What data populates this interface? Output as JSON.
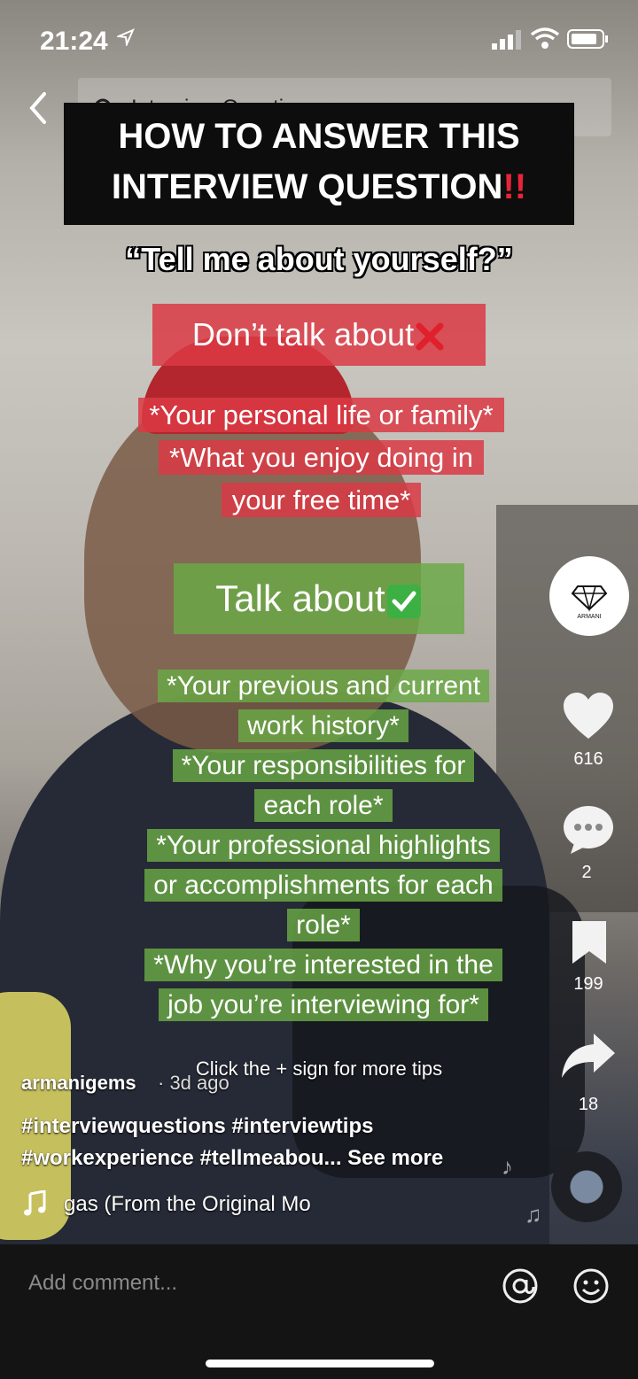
{
  "status_bar": {
    "time": "21:24"
  },
  "search": {
    "query": "Interview Questions"
  },
  "overlay": {
    "title_line1": "HOW TO ANSWER THIS",
    "title_line2": "INTERVIEW QUESTION",
    "title_emoji": "!!",
    "question": "“Tell me about yourself?”",
    "dont_heading": "Don’t talk about",
    "dont_items": [
      "*Your personal life or family*",
      "*What you enjoy doing in",
      "your free time*"
    ],
    "do_heading": "Talk about",
    "do_items": [
      "*Your previous and current",
      "work history*",
      "*Your responsibilities for",
      "each role*",
      "*Your professional highlights",
      "or accomplishments for each",
      "role*",
      "*Why you’re interested in the",
      "job you’re interviewing for*"
    ],
    "tip": "Click the + sign for more tips"
  },
  "rail": {
    "likes": "616",
    "comments": "2",
    "saves": "199",
    "shares": "18",
    "avatar_brand": "ARMANI"
  },
  "caption": {
    "username": "armanigems",
    "age": "· 3d ago",
    "hashtags_line1": "#interviewquestions #interviewtips",
    "hashtags_line2": "#workexperience #tellmeabou...",
    "see_more": "See more",
    "song": "gas (From the Original Mo"
  },
  "comment_bar": {
    "placeholder": "Add comment..."
  },
  "colors": {
    "red_box": "#da3a44",
    "green_box": "#6aaa46",
    "title_bg": "#0d0d0d"
  }
}
